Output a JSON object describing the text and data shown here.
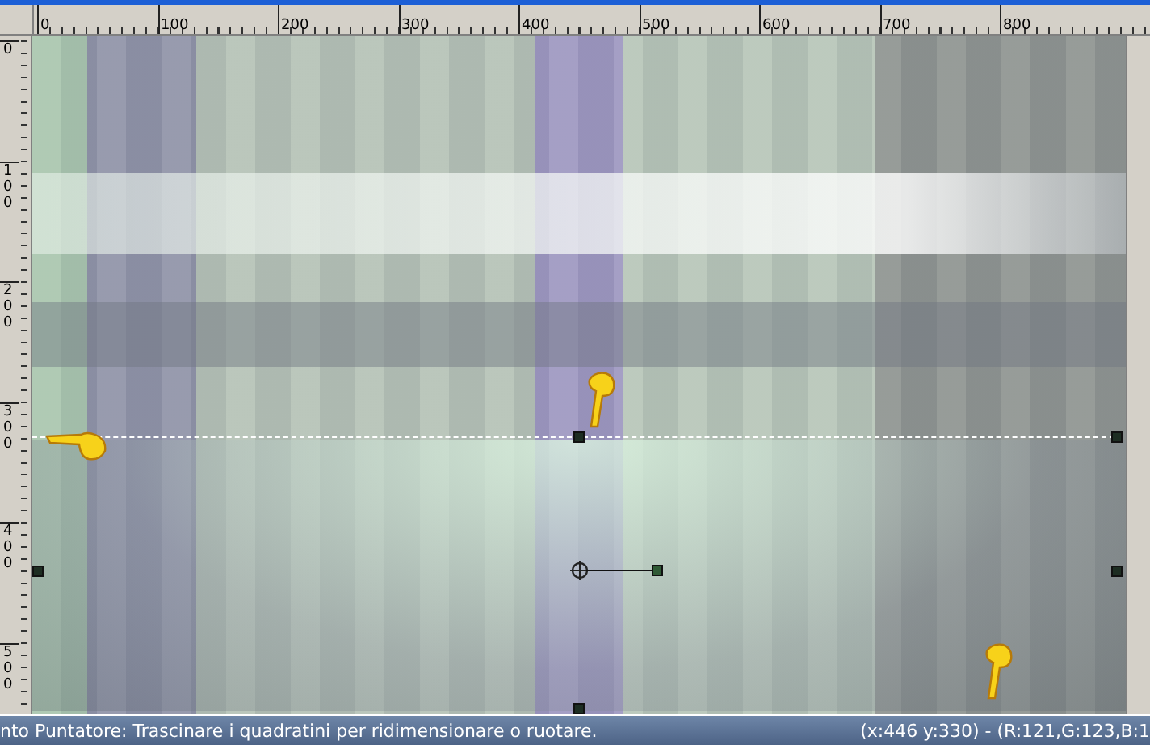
{
  "top_ruler": {
    "labels": [
      "0",
      "100",
      "200",
      "300",
      "400",
      "500",
      "600",
      "700",
      "800"
    ]
  },
  "left_ruler": {
    "labels": [
      "0",
      "100",
      "200",
      "300",
      "400",
      "500"
    ]
  },
  "status_bar": {
    "message": "nto Puntatore: Trascinare i quadratini per ridimensionare o ruotare.",
    "readout": "(x:446 y:330) - (R:121,G:123,B:1"
  }
}
